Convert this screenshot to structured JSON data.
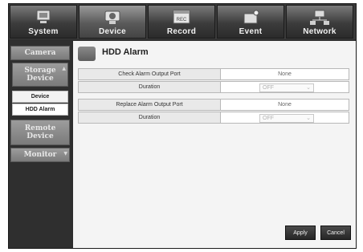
{
  "tabs": [
    {
      "label": "System",
      "icon": "monitor-icon"
    },
    {
      "label": "Device",
      "icon": "camera-icon"
    },
    {
      "label": "Record",
      "icon": "record-icon"
    },
    {
      "label": "Event",
      "icon": "event-icon"
    },
    {
      "label": "Network",
      "icon": "network-icon"
    }
  ],
  "active_tab": "Device",
  "sidebar": {
    "camera": "Camera",
    "storage_device": "Storage Device",
    "sub_device": "Device",
    "sub_hdd_alarm": "HDD Alarm",
    "remote_device": "Remote Device",
    "monitor": "Monitor"
  },
  "page": {
    "title": "HDD Alarm",
    "check_alarm_label": "Check Alarm Output Port",
    "check_alarm_value": "None",
    "check_duration_label": "Duration",
    "check_duration_value": "OFF",
    "replace_alarm_label": "Replace Alarm Output Port",
    "replace_alarm_value": "None",
    "replace_duration_label": "Duration",
    "replace_duration_value": "OFF"
  },
  "buttons": {
    "apply": "Apply",
    "cancel": "Cancel"
  },
  "colors": {
    "frame": "#2e2e2e",
    "panel": "#f4f4f4",
    "button": "#2a2a2a"
  }
}
